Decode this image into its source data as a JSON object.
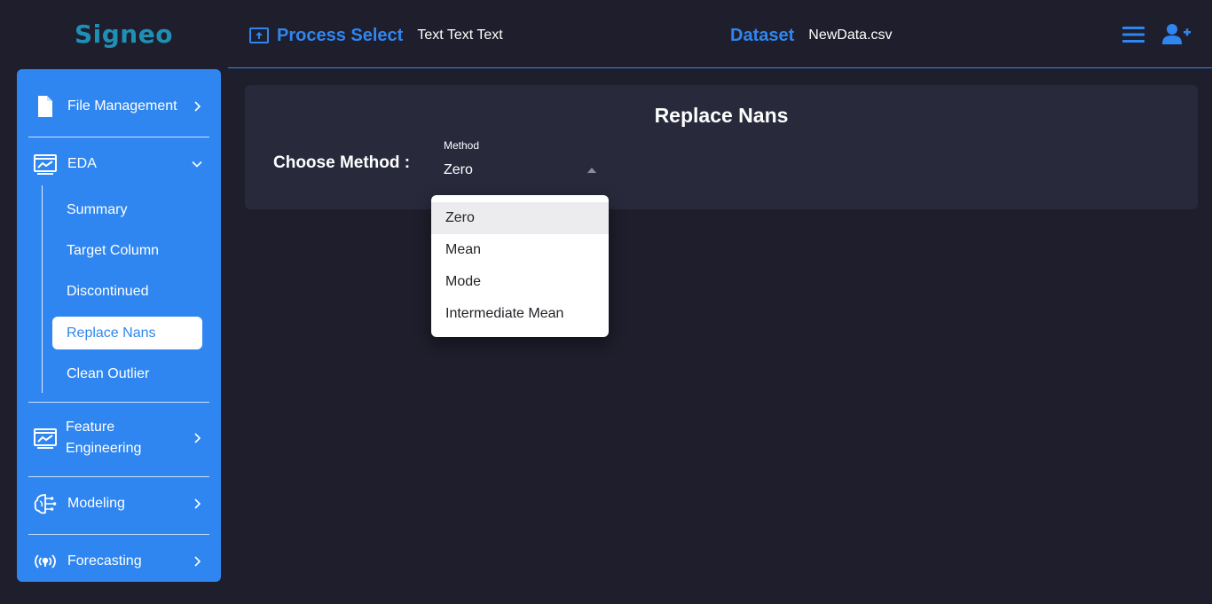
{
  "brand": {
    "logo_text": "Signeo"
  },
  "header": {
    "process_title": "Process Select",
    "process_value": "Text Text Text",
    "dataset_title": "Dataset",
    "dataset_value": "NewData.csv",
    "menu_icon": "hamburger-menu-icon",
    "add_user_icon": "add-user-icon"
  },
  "sidebar": {
    "items": [
      {
        "label": "File Management",
        "icon": "file-icon",
        "expanded": false
      },
      {
        "label": "EDA",
        "icon": "chart-board-icon",
        "expanded": true
      },
      {
        "label": "Feature",
        "label2": "Engineering",
        "icon": "chart-board-icon",
        "expanded": false
      },
      {
        "label": "Modeling",
        "icon": "brain-circuit-icon",
        "expanded": false
      },
      {
        "label": "Forecasting",
        "icon": "broadcast-icon",
        "expanded": false
      }
    ],
    "eda_subitems": [
      {
        "label": "Summary"
      },
      {
        "label": "Target Column"
      },
      {
        "label": "Discontinued"
      },
      {
        "label": "Replace Nans",
        "active": true
      },
      {
        "label": "Clean Outlier"
      }
    ]
  },
  "main": {
    "card_title": "Replace Nans",
    "choose_label": "Choose Method :",
    "select": {
      "floating_label": "Method",
      "value": "Zero",
      "options": [
        "Zero",
        "Mean",
        "Mode",
        "Intermediate Mean"
      ],
      "selected_index": 0
    }
  },
  "colors": {
    "background": "#1e1e2c",
    "accent": "#2f86f0",
    "card": "#282a3c",
    "logo": "#1f8fb6"
  }
}
